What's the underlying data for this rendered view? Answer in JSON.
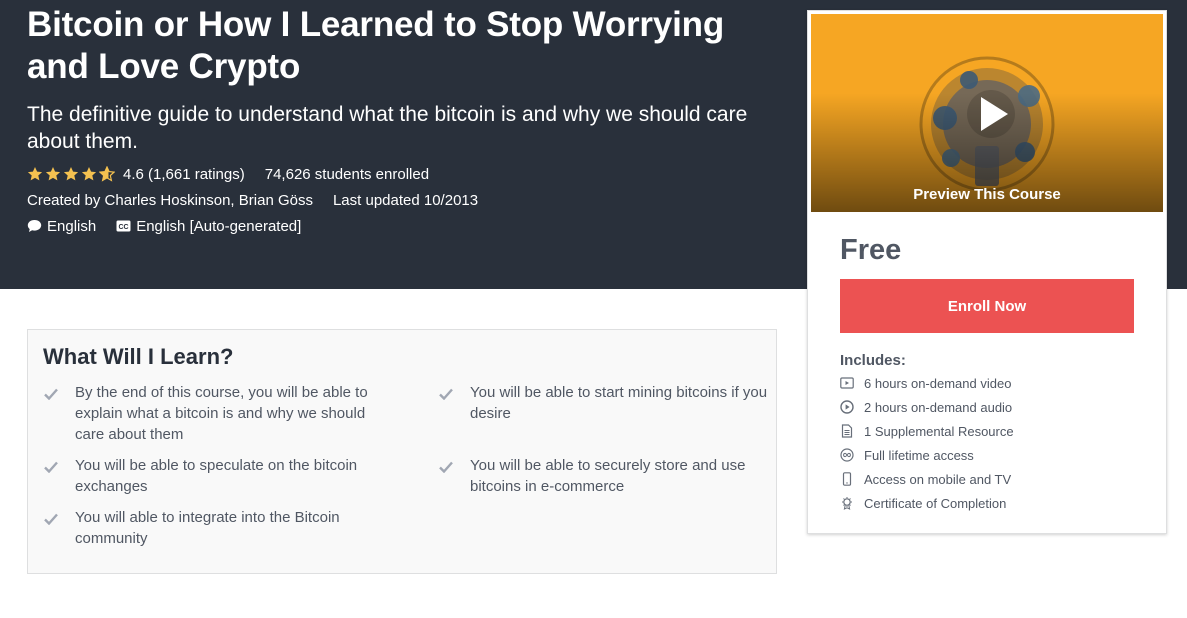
{
  "course": {
    "title": "Bitcoin or How I Learned to Stop Worrying and Love Crypto",
    "subtitle": "The definitive guide to understand what the bitcoin is and why we should care about them.",
    "rating_value": 4.6,
    "rating_text": "4.6 (1,661 ratings)",
    "students": "74,626 students enrolled",
    "created_by": "Created by Charles Hoskinson, Brian Göss",
    "last_updated": "Last updated 10/2013",
    "language": "English",
    "captions": "English [Auto-generated]"
  },
  "learn": {
    "title": "What Will I Learn?",
    "items": [
      "By the end of this course, you will be able to explain what a bitcoin is and why we should care about them",
      "You will be able to start mining bitcoins if you desire",
      "You will be able to speculate on the bitcoin exchanges",
      "You will be able to securely store and use bitcoins in e-commerce",
      "You will able to integrate into the Bitcoin community"
    ]
  },
  "sidebar": {
    "preview_label": "Preview This Course",
    "price": "Free",
    "enroll_label": "Enroll Now",
    "includes_title": "Includes:",
    "includes": [
      {
        "icon": "video-icon",
        "text": "6 hours on-demand video"
      },
      {
        "icon": "audio-play-icon",
        "text": "2 hours on-demand audio"
      },
      {
        "icon": "document-icon",
        "text": "1 Supplemental Resource"
      },
      {
        "icon": "infinity-icon",
        "text": "Full lifetime access"
      },
      {
        "icon": "mobile-icon",
        "text": "Access on mobile and TV"
      },
      {
        "icon": "certificate-icon",
        "text": "Certificate of Completion"
      }
    ]
  },
  "colors": {
    "hero_bg": "#29303b",
    "star": "#f4c150",
    "enroll": "#ec5252",
    "preview_bg": "#f6a623"
  }
}
